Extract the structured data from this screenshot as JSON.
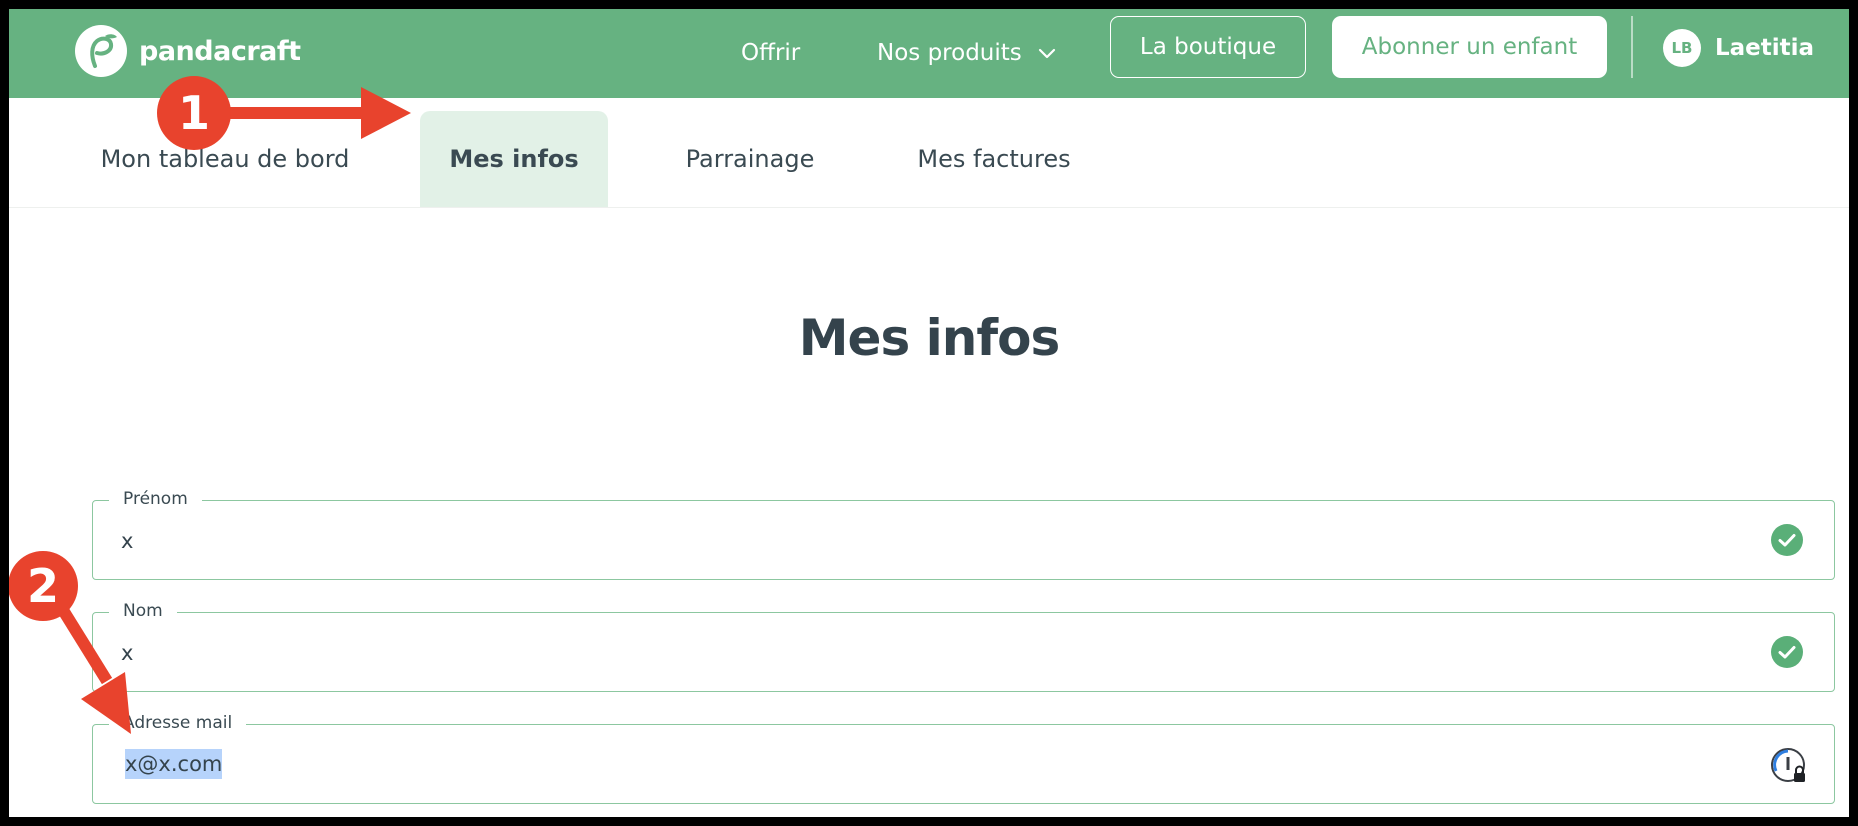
{
  "header": {
    "logo_text": "pandacraft",
    "nav": {
      "offrir": "Offrir",
      "produits": "Nos produits"
    },
    "boutique_label": "La boutique",
    "abonner_label": "Abonner un enfant",
    "user": {
      "initials": "LB",
      "name": "Laetitia"
    }
  },
  "tabs": [
    {
      "label": "Mon tableau de bord"
    },
    {
      "label": "Mes infos"
    },
    {
      "label": "Parrainage"
    },
    {
      "label": "Mes factures"
    }
  ],
  "page": {
    "title": "Mes infos"
  },
  "fields": {
    "prenom": {
      "label": "Prénom",
      "value": "x",
      "icon": "check-circle-icon"
    },
    "nom": {
      "label": "Nom",
      "value": "x",
      "icon": "check-circle-icon"
    },
    "mail": {
      "label": "Adresse mail",
      "value": "x@x.com",
      "icon": "password-manager-icon"
    }
  },
  "annotations": [
    {
      "number": "1"
    },
    {
      "number": "2"
    }
  ],
  "colors": {
    "brand_green": "#66b281",
    "active_tab_bg": "#e2f1e7",
    "annotation_red": "#e8432d",
    "field_border": "#8cc7a0",
    "check_green": "#5aaf78"
  }
}
